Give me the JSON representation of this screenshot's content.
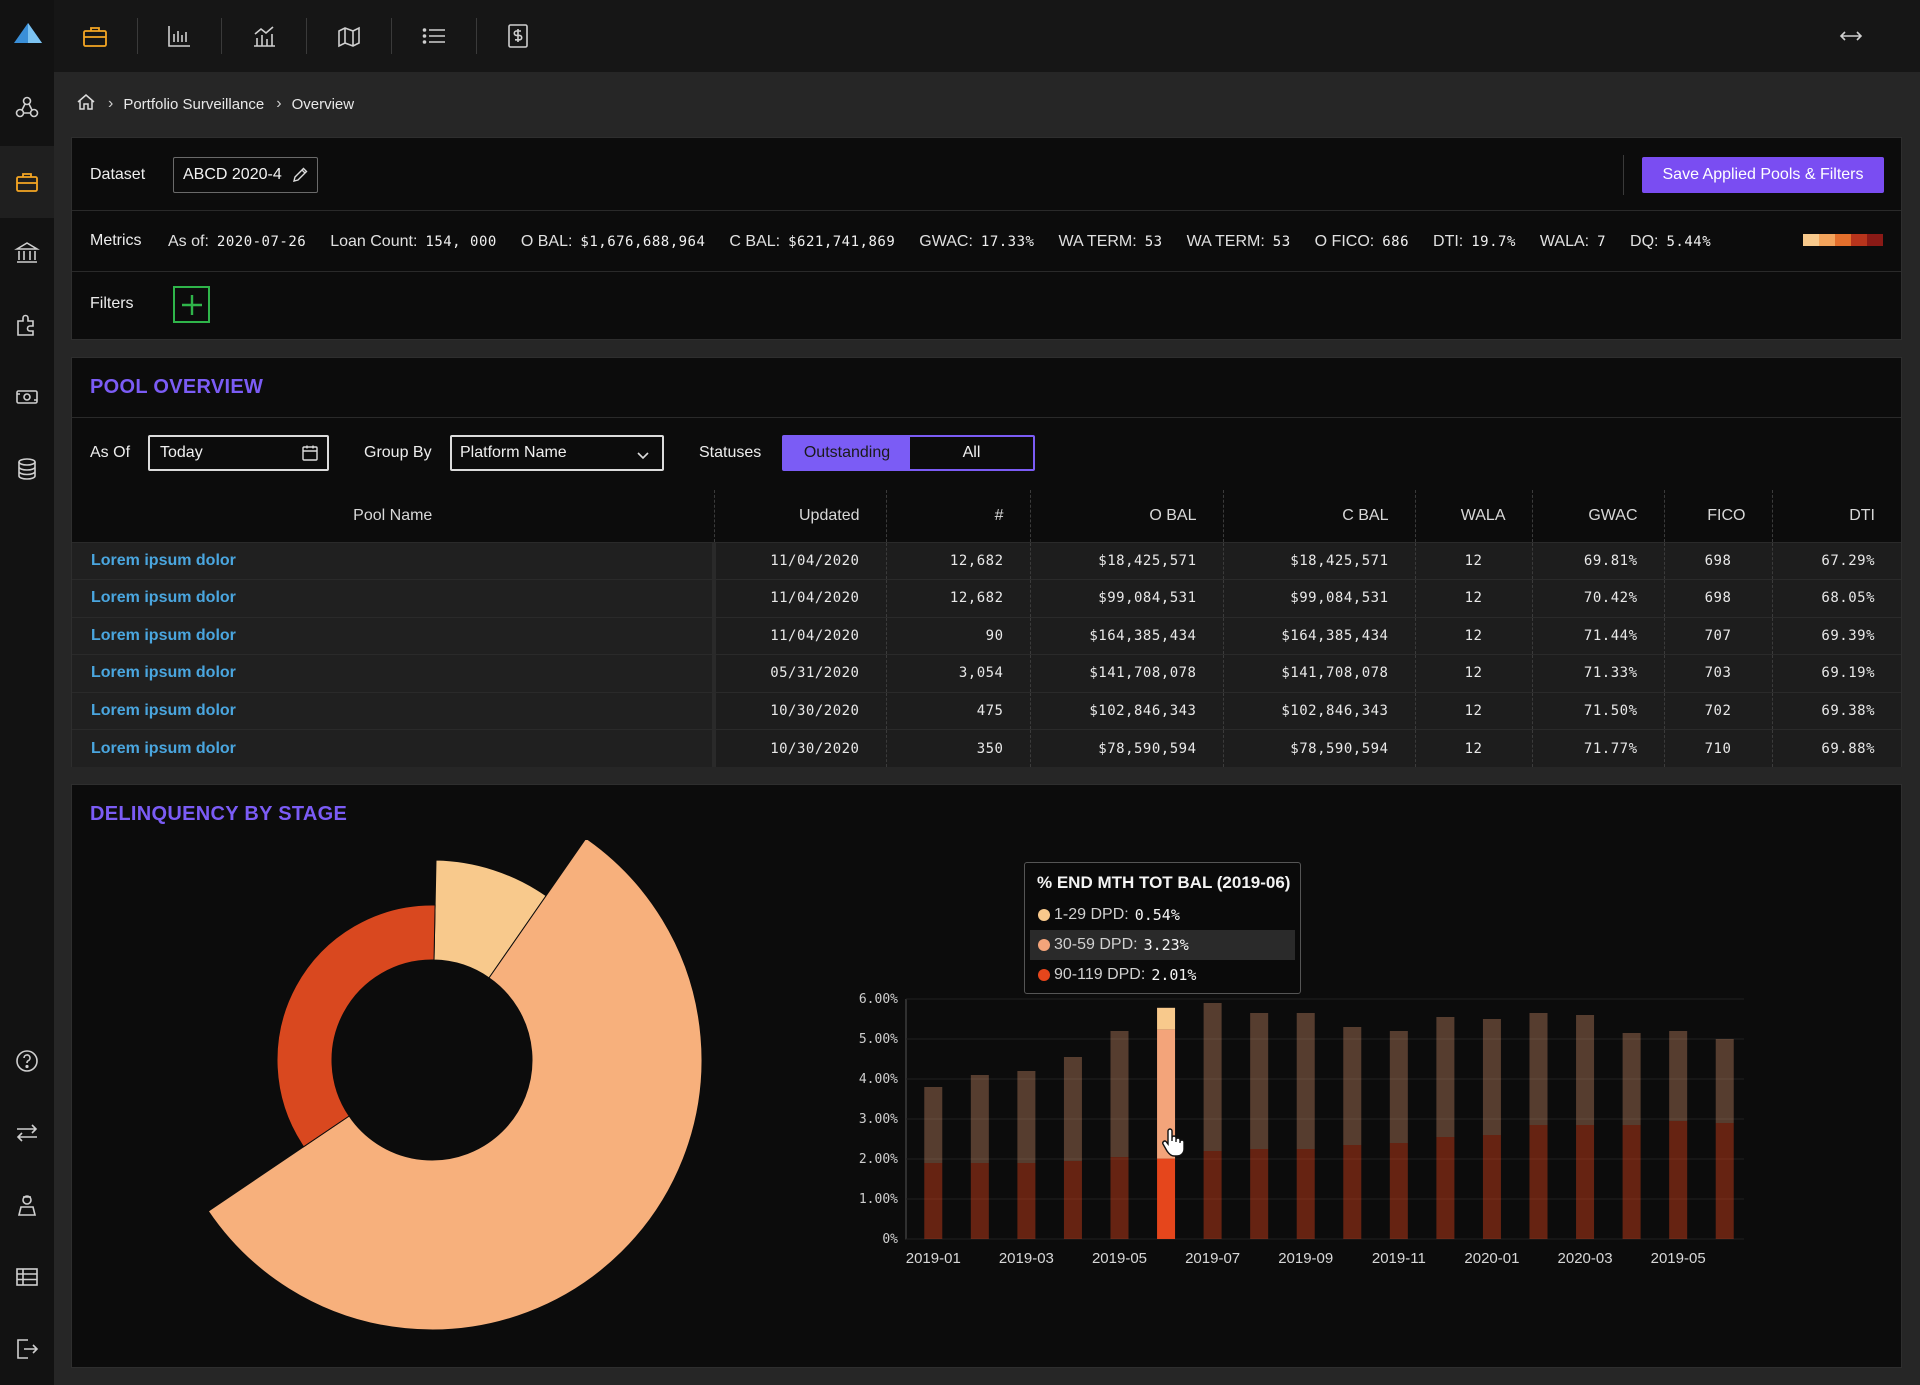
{
  "breadcrumb": {
    "items": [
      "Portfolio Surveillance",
      "Overview"
    ]
  },
  "dataset": {
    "label": "Dataset",
    "value": "ABCD 2020-4",
    "save_label": "Save Applied Pools & Filters"
  },
  "metrics": {
    "label": "Metrics",
    "items": [
      {
        "name": "As of:",
        "value": "2020-07-26"
      },
      {
        "name": "Loan Count:",
        "value": "154, 000"
      },
      {
        "name": "O BAL:",
        "value": "$1,676,688,964"
      },
      {
        "name": "C BAL:",
        "value": "$621,741,869"
      },
      {
        "name": "GWAC:",
        "value": "17.33%"
      },
      {
        "name": "WA TERM:",
        "value": "53"
      },
      {
        "name": "WA TERM:",
        "value": "53"
      },
      {
        "name": "O FICO:",
        "value": "686"
      },
      {
        "name": "DTI:",
        "value": "19.7%"
      },
      {
        "name": "WALA:",
        "value": "7"
      },
      {
        "name": "DQ:",
        "value": "5.44%"
      }
    ],
    "dq_colors": [
      "#f8c98c",
      "#f3a45c",
      "#e36f2c",
      "#b7341c",
      "#8a1a16"
    ]
  },
  "filters": {
    "label": "Filters"
  },
  "pool_overview": {
    "title": "POOL OVERVIEW",
    "as_of_label": "As Of",
    "as_of_value": "Today",
    "group_by_label": "Group By",
    "group_by_value": "Platform Name",
    "statuses_label": "Statuses",
    "status_on": "Outstanding",
    "status_off": "All",
    "columns": [
      "Pool Name",
      "Updated",
      "#",
      "O BAL",
      "C BAL",
      "WALA",
      "GWAC",
      "FICO",
      "DTI"
    ],
    "rows": [
      [
        "Lorem ipsum dolor",
        "11/04/2020",
        "12,682",
        "$18,425,571",
        "$18,425,571",
        "12",
        "69.81%",
        "698",
        "67.29%"
      ],
      [
        "Lorem ipsum dolor",
        "11/04/2020",
        "12,682",
        "$99,084,531",
        "$99,084,531",
        "12",
        "70.42%",
        "698",
        "68.05%"
      ],
      [
        "Lorem ipsum dolor",
        "11/04/2020",
        "90",
        "$164,385,434",
        "$164,385,434",
        "12",
        "71.44%",
        "707",
        "69.39%"
      ],
      [
        "Lorem ipsum dolor",
        "05/31/2020",
        "3,054",
        "$141,708,078",
        "$141,708,078",
        "12",
        "71.33%",
        "703",
        "69.19%"
      ],
      [
        "Lorem ipsum dolor",
        "10/30/2020",
        "475",
        "$102,846,343",
        "$102,846,343",
        "12",
        "71.50%",
        "702",
        "69.38%"
      ],
      [
        "Lorem ipsum dolor",
        "10/30/2020",
        "350",
        "$78,590,594",
        "$78,590,594",
        "12",
        "71.77%",
        "710",
        "69.88%"
      ]
    ]
  },
  "delinquency": {
    "title": "DELINQUENCY BY STAGE",
    "tooltip": {
      "title": "% END MTH TOT BAL (2019-06)",
      "rows": [
        {
          "label": "1-29 DPD:",
          "value": "0.54%",
          "color": "#f8c98c"
        },
        {
          "label": "30-59 DPD:",
          "value": "3.23%",
          "color": "#f3a47a"
        },
        {
          "label": "90-119 DPD:",
          "value": "2.01%",
          "color": "#e5461c"
        }
      ]
    }
  },
  "chart_data": [
    {
      "type": "pie",
      "style": "donut",
      "labels": [
        "1-29 DPD",
        "30-59 DPD",
        "90-119 DPD"
      ],
      "values": [
        0.54,
        3.23,
        2.01
      ],
      "colors": [
        "#f8c98c",
        "#f7b07c",
        "#d9481f"
      ]
    },
    {
      "type": "bar",
      "stacked": true,
      "x": [
        "2019-01",
        "2019-02",
        "2019-03",
        "2019-04",
        "2019-05",
        "2019-06",
        "2019-07",
        "2019-08",
        "2019-09",
        "2019-10",
        "2019-11",
        "2019-12",
        "2020-01",
        "2020-02",
        "2020-03",
        "2020-04",
        "2020-05",
        "2020-06"
      ],
      "tick_labels": [
        "2019-01",
        "2019-03",
        "2019-05",
        "2019-07",
        "2019-09",
        "2019-11",
        "2020-01",
        "2020-03",
        "2019-05"
      ],
      "yticks": [
        "0%",
        "1.00%",
        "2.00%",
        "3.00%",
        "4.00%",
        "5.00%",
        "6.00%"
      ],
      "ylim": [
        0,
        6
      ],
      "highlight_index": 5,
      "series": [
        {
          "values": [
            1.9,
            1.9,
            1.9,
            1.95,
            2.05,
            2.01,
            2.2,
            2.25,
            2.25,
            2.35,
            2.4,
            2.55,
            2.6,
            2.85,
            2.85,
            2.85,
            2.95,
            2.9
          ],
          "color": "#e5461c"
        },
        {
          "values": [
            1.9,
            2.2,
            2.3,
            2.6,
            3.15,
            3.23,
            3.7,
            3.4,
            3.4,
            2.95,
            2.8,
            3.0,
            2.9,
            2.8,
            2.75,
            2.3,
            2.25,
            2.1
          ],
          "color": "#f3a47a"
        },
        {
          "values": [
            0.0,
            0.0,
            0.0,
            0.0,
            0.0,
            0.54,
            0.0,
            0.0,
            0.0,
            0.0,
            0.0,
            0.0,
            0.0,
            0.0,
            0.0,
            0.0,
            0.0,
            0.0
          ],
          "color": "#f8c98c"
        }
      ]
    }
  ]
}
